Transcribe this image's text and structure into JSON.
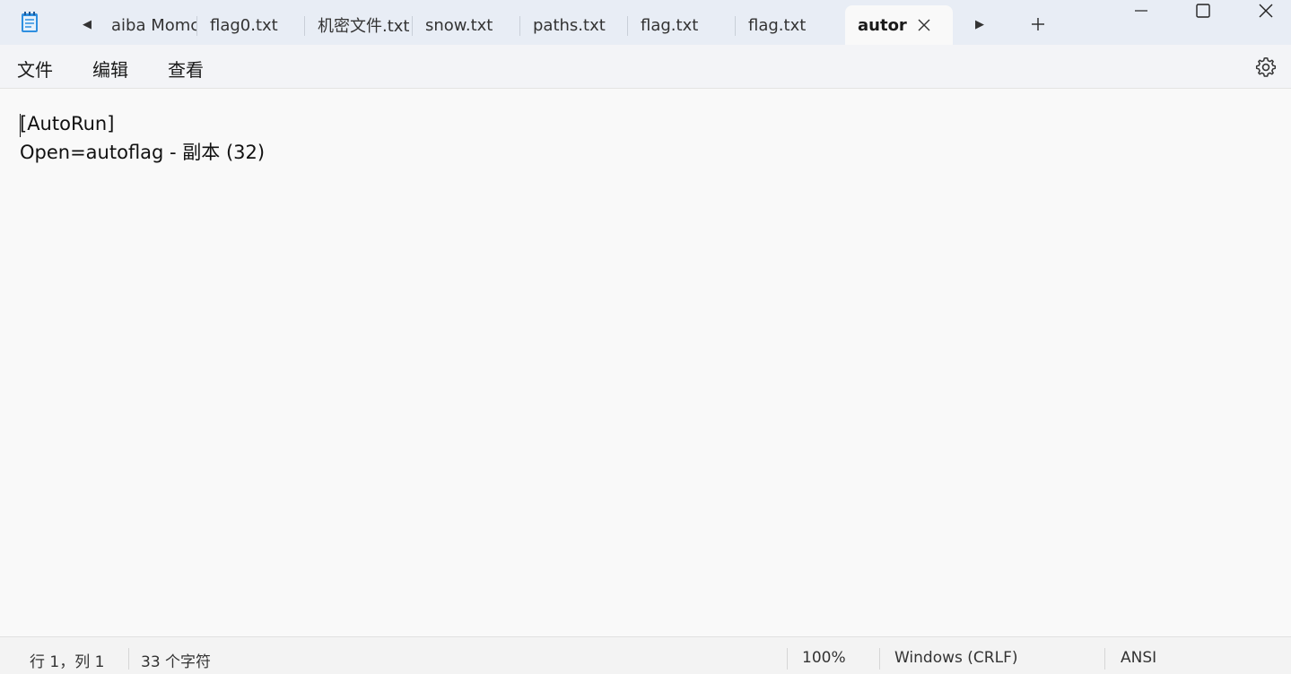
{
  "tabs": [
    {
      "label": "aiba Momc"
    },
    {
      "label": "flag0.txt"
    },
    {
      "label": "机密文件.txt"
    },
    {
      "label": "snow.txt"
    },
    {
      "label": "paths.txt"
    },
    {
      "label": "flag.txt"
    },
    {
      "label": "flag.txt"
    },
    {
      "label": "autor",
      "active": true
    }
  ],
  "icons": {
    "app": "notepad-icon",
    "scroll_left": "chevron-left-icon",
    "scroll_right": "chevron-right-icon",
    "close_tab": "close-icon",
    "new_tab": "plus-icon",
    "minimize": "minimize-icon",
    "maximize": "maximize-icon",
    "close_window": "close-icon",
    "settings": "gear-icon"
  },
  "menu": {
    "file": "文件",
    "edit": "编辑",
    "view": "查看"
  },
  "editor": {
    "lines": [
      "[AutoRun]",
      "Open=autoflag - 副本 (32)"
    ]
  },
  "status": {
    "position": "行 1，列 1",
    "char_count": "33 个字符",
    "zoom": "100%",
    "line_ending": "Windows (CRLF)",
    "encoding": "ANSI"
  },
  "colors": {
    "titlebar": "#e8edf5",
    "active_tab": "#f9f9f9",
    "app_icon": "#2f8fe0"
  }
}
